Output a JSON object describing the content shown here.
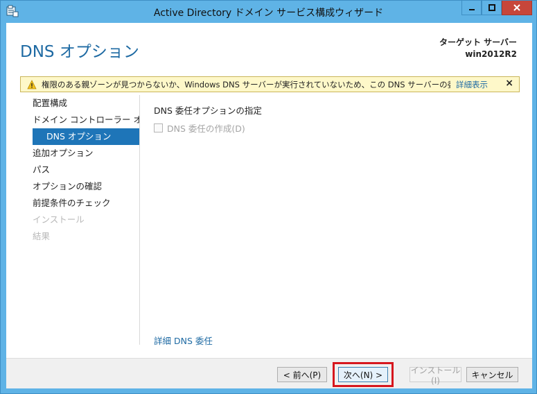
{
  "window": {
    "title": "Active Directory ドメイン サービス構成ウィザード"
  },
  "header": {
    "page_title": "DNS オプション",
    "target_label": "ターゲット サーバー",
    "target_name": "win2012R2"
  },
  "warning": {
    "text": "権限のある親ゾーンが見つからないか、Windows DNS サーバーが実行されていないため、この DNS サーバーの委任を作…",
    "link": "詳細表示",
    "close": "×"
  },
  "nav": {
    "items": [
      {
        "label": "配置構成",
        "state": "normal"
      },
      {
        "label": "ドメイン コントローラー オプ…",
        "state": "normal"
      },
      {
        "label": "DNS オプション",
        "state": "active"
      },
      {
        "label": "追加オプション",
        "state": "normal"
      },
      {
        "label": "パス",
        "state": "normal"
      },
      {
        "label": "オプションの確認",
        "state": "normal"
      },
      {
        "label": "前提条件のチェック",
        "state": "normal"
      },
      {
        "label": "インストール",
        "state": "disabled"
      },
      {
        "label": "結果",
        "state": "disabled"
      }
    ]
  },
  "content": {
    "section_label": "DNS 委任オプションの指定",
    "checkbox_label": "DNS 委任の作成(D)",
    "checkbox_checked": false,
    "checkbox_enabled": false,
    "bottom_link": "詳細 DNS 委任"
  },
  "footer": {
    "prev": "< 前へ(P)",
    "next": "次へ(N) >",
    "install": "インストール(I)",
    "cancel": "キャンセル"
  },
  "colors": {
    "accent": "#1e75b8",
    "link": "#1e6aa3",
    "frame": "#5fb3e6",
    "highlight": "#d6161d",
    "warning_bg": "#fef8c9"
  }
}
